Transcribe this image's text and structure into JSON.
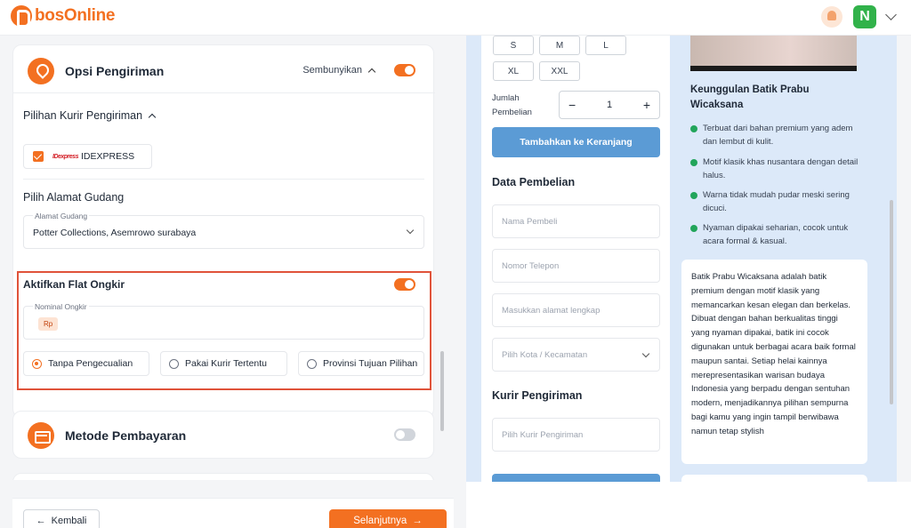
{
  "app": {
    "name": "bosOnline"
  },
  "header": {
    "avatar_letter": "N",
    "accent": "#f37021"
  },
  "shipping": {
    "title": "Opsi Pengiriman",
    "hide_label": "Sembunyikan",
    "enabled": true,
    "courier_section_title": "Pilihan Kurir Pengiriman",
    "courier": {
      "logo": "IDexpress",
      "name": "IDEXPRESS",
      "checked": true
    },
    "warehouse_title": "Pilih Alamat Gudang",
    "warehouse_field_label": "Alamat Gudang",
    "warehouse_value": "Potter Collections, Asemrowo surabaya",
    "flat_title": "Aktifkan Flat Ongkir",
    "flat_enabled": true,
    "nominal_label": "Nominal Ongkir",
    "currency": "Rp",
    "options": [
      {
        "label": "Tanpa Pengecualian",
        "selected": true
      },
      {
        "label": "Pakai Kurir Tertentu",
        "selected": false
      },
      {
        "label": "Provinsi Tujuan Pilihan",
        "selected": false
      }
    ]
  },
  "payment": {
    "title": "Metode Pembayaran",
    "enabled": false
  },
  "footer": {
    "back_label": "Kembali",
    "next_label": "Selanjutnya"
  },
  "preview": {
    "sizes": [
      "S",
      "M",
      "L",
      "XL",
      "XXL"
    ],
    "qty_label": "Jumlah Pembelian",
    "qty_value": "1",
    "add_cart_label": "Tambahkan ke Keranjang",
    "purchase_title": "Data Pembelian",
    "inputs": {
      "name": "Nama Pembeli",
      "phone": "Nomor Telepon",
      "address": "Masukkan alamat lengkap",
      "city": "Pilih Kota / Kecamatan"
    },
    "courier_title": "Kurir Pengiriman",
    "courier_placeholder": "Pilih Kurir Pengiriman",
    "advantages_title": "Keunggulan Batik Prabu Wicaksana",
    "advantages": [
      "Terbuat dari bahan premium yang adem dan lembut di kulit.",
      "Motif klasik khas nusantara dengan detail halus.",
      "Warna tidak mudah pudar meski sering dicuci.",
      "Nyaman dipakai seharian, cocok untuk acara formal & kasual."
    ],
    "description": "Batik Prabu Wicaksana adalah batik premium dengan motif klasik yang memancarkan kesan elegan dan berkelas. Dibuat dengan bahan berkualitas tinggi yang nyaman dipakai, batik ini cocok digunakan untuk berbagai acara baik formal maupun santai. Setiap helai kainnya merepresentasikan warisan budaya Indonesia yang berpadu dengan sentuhan modern, menjadikannya pilihan sempurna bagi kamu yang ingin tampil berwibawa namun tetap stylish"
  }
}
